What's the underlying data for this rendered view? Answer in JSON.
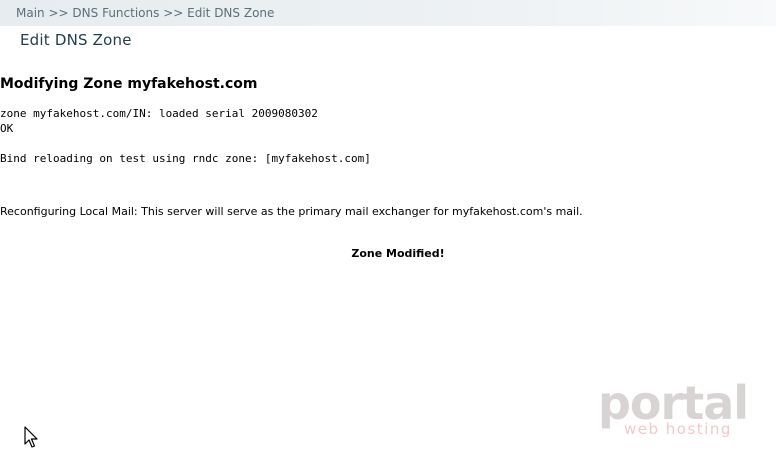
{
  "breadcrumb": {
    "items": [
      "Main",
      "DNS Functions",
      "Edit DNS Zone"
    ],
    "separator": ">>"
  },
  "header": {
    "title": "Edit DNS Zone"
  },
  "main": {
    "section_title": "Modifying Zone myfakehost.com",
    "output_lines": [
      "zone myfakehost.com/IN: loaded serial 2009080302",
      "OK",
      "Bind reloading on test using rndc zone: [myfakehost.com]"
    ],
    "mail_message": "Reconfiguring Local Mail: This server will serve as the primary mail exchanger for myfakehost.com's mail.",
    "result": "Zone Modified!"
  },
  "logo": {
    "word": "portal",
    "tagline": "web hosting"
  },
  "colors": {
    "breadcrumb_bg": "#e6ecef",
    "breadcrumb_text": "#5d6f78",
    "title_text": "#1f3d4d",
    "logo_gray": "#d9d4d4",
    "logo_pink": "#f2c8c8"
  }
}
